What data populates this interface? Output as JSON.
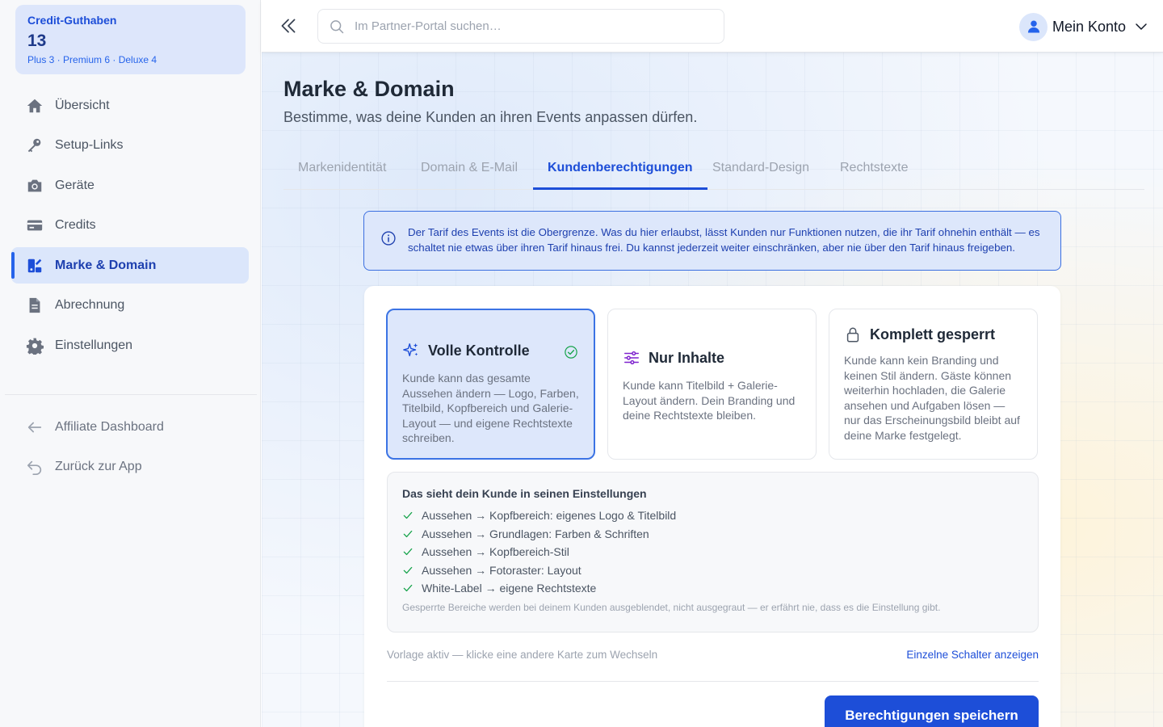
{
  "sidebar": {
    "credit": {
      "title": "Credit-Guthaben",
      "count": "13",
      "breakdown": "Plus 3 · Premium 6 · Deluxe 4"
    },
    "items": [
      {
        "label": "Übersicht",
        "icon": "home-icon"
      },
      {
        "label": "Setup-Links",
        "icon": "key-icon"
      },
      {
        "label": "Geräte",
        "icon": "camera-icon"
      },
      {
        "label": "Credits",
        "icon": "credit-card-icon"
      },
      {
        "label": "Marke & Domain",
        "icon": "brand-icon",
        "active": true
      },
      {
        "label": "Abrechnung",
        "icon": "document-icon"
      },
      {
        "label": "Einstellungen",
        "icon": "gear-icon"
      }
    ],
    "secondary": [
      {
        "label": "Affiliate Dashboard",
        "icon": "arrow-left-icon"
      },
      {
        "label": "Zurück zur App",
        "icon": "undo-icon"
      }
    ]
  },
  "topbar": {
    "search_placeholder": "Im Partner-Portal suchen…",
    "account_label": "Mein Konto"
  },
  "page": {
    "title": "Marke & Domain",
    "subtitle": "Bestimme, was deine Kunden an ihren Events anpassen dürfen."
  },
  "tabs": [
    {
      "label": "Markenidentität"
    },
    {
      "label": "Domain & E-Mail"
    },
    {
      "label": "Kundenberechtigungen",
      "active": true
    },
    {
      "label": "Standard-Design"
    },
    {
      "label": "Rechtstexte"
    }
  ],
  "info": {
    "line1": "Der Tarif des Events ist die Obergrenze. Was du hier erlaubst, lässt Kunden nur Funktionen nutzen, die ihr Tarif ohnehin enthält — es",
    "line2": "schaltet nie etwas über ihren Tarif hinaus frei. Du kannst jederzeit weiter einschränken, aber nie über den Tarif hinaus freigeben."
  },
  "cards": [
    {
      "title": "Volle Kontrolle",
      "icon": "sparkles-icon",
      "description": "Kunde kann das gesamte Aussehen ändern — Logo, Farben, Titelbild, Kopfbereich und Galerie-Layout — und eigene Rechtstexte schreiben.",
      "selected": true
    },
    {
      "title": "Nur Inhalte",
      "icon": "sliders-icon",
      "description": "Kunde kann Titelbild + Galerie-Layout ändern. Dein Branding und deine Rechtstexte bleiben."
    },
    {
      "title": "Komplett gesperrt",
      "icon": "lock-icon",
      "description": "Kunde kann kein Branding und keinen Stil ändern. Gäste können weiterhin hochladen, die Galerie ansehen und Aufgaben lösen — nur das Erscheinungsbild bleibt auf deine Marke festgelegt."
    }
  ],
  "preview": {
    "title": "Das sieht dein Kunde in seinen Einstellungen",
    "items": [
      "Aussehen → Kopfbereich: eigenes Logo & Titelbild",
      "Aussehen → Grundlagen: Farben & Schriften",
      "Aussehen → Kopfbereich-Stil",
      "Aussehen → Fotoraster: Layout",
      "White-Label → eigene Rechtstexte"
    ],
    "note": "Gesperrte Bereiche werden bei deinem Kunden ausgeblendet, nicht ausgegraut — er erfährt nie, dass es die Einstellung gibt."
  },
  "footer": {
    "hint": "Vorlage aktiv — klicke eine andere Karte zum Wechseln",
    "link": "Einzelne Schalter anzeigen",
    "save": "Berechtigungen speichern"
  },
  "colors": {
    "accent": "#1d4ed8",
    "selected_bg": "#dde7fb",
    "success": "#16a34a"
  }
}
